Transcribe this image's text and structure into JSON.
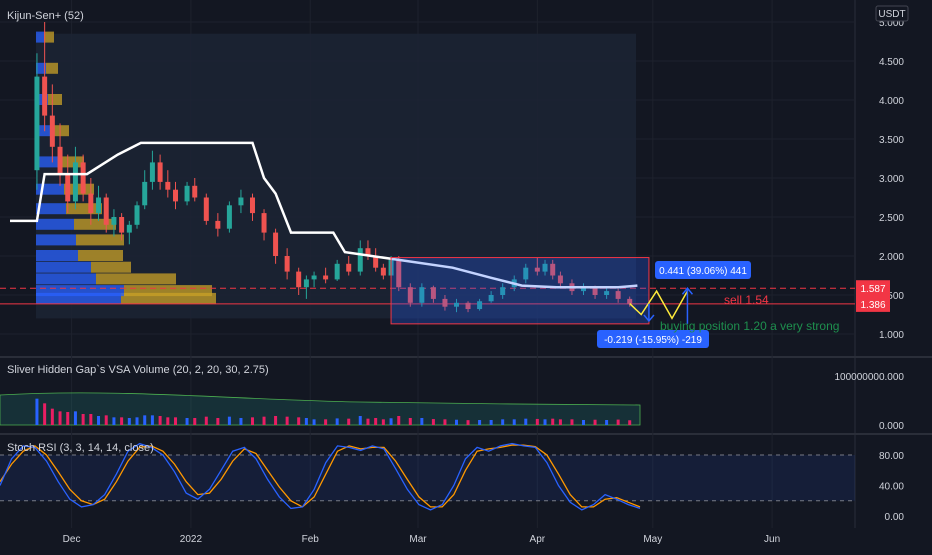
{
  "currency": "USDT",
  "panes": {
    "price": {
      "indicator_label": "Kijun-Sen+ (52)",
      "yticks": [
        "5.000",
        "4.500",
        "4.000",
        "3.500",
        "3.000",
        "2.500",
        "2.000",
        "1.500",
        "1.000"
      ],
      "price_badges": [
        {
          "label": "1.587",
          "color": "#f23645"
        },
        {
          "label": "1.386",
          "color": "#f23645"
        }
      ]
    },
    "volume": {
      "indicator_label": "Sliver Hidden Gap`s VSA Volume (20, 2, 20, 30, 2.75)",
      "yticks": [
        "100000000.000",
        "0.000"
      ]
    },
    "stoch": {
      "indicator_label": "Stoch RSI (3, 3, 14, 14, close)",
      "yticks": [
        "80.00",
        "40.00",
        "0.00"
      ]
    }
  },
  "time_axis": [
    "Dec",
    "2022",
    "Feb",
    "Mar",
    "Apr",
    "May",
    "Jun"
  ],
  "annotations": {
    "upper_measure": "0.441 (39.06%) 441",
    "lower_measure": "-0.219 (-15.95%) -219",
    "sell_text": "sell 1.54",
    "buy_text": "buying position 1.20 a very strong"
  },
  "colors": {
    "background": "#131722",
    "up": "#26a69a",
    "down": "#ef5350",
    "kijun": "#ffffff",
    "profile_blue": "#2962ff",
    "profile_gold": "#c9a227",
    "stoch_k": "#2962ff",
    "stoch_d": "#ff9800",
    "badge_blue": "#2962ff",
    "sell_red": "#f23645",
    "buy_green": "#1e8f4e"
  },
  "chart_data": {
    "type": "candlestick",
    "y_range": [
      0.8,
      5.15
    ],
    "x_range": [
      "2021-11-15",
      "2022-06-15"
    ],
    "price_lines": [
      1.587,
      1.386
    ],
    "candles": [
      {
        "date": "2021-11-22",
        "open": 3.1,
        "high": 4.6,
        "low": 2.85,
        "close": 4.3
      },
      {
        "date": "2021-11-24",
        "open": 4.3,
        "high": 5.0,
        "low": 3.6,
        "close": 3.8
      },
      {
        "date": "2021-11-26",
        "open": 3.8,
        "high": 4.2,
        "low": 3.2,
        "close": 3.4
      },
      {
        "date": "2021-11-28",
        "open": 3.4,
        "high": 3.7,
        "low": 2.9,
        "close": 3.05
      },
      {
        "date": "2021-11-30",
        "open": 3.05,
        "high": 3.3,
        "low": 2.55,
        "close": 2.7
      },
      {
        "date": "2021-12-02",
        "open": 2.7,
        "high": 3.4,
        "low": 2.6,
        "close": 3.2
      },
      {
        "date": "2021-12-04",
        "open": 3.2,
        "high": 3.3,
        "low": 2.7,
        "close": 2.8
      },
      {
        "date": "2021-12-06",
        "open": 2.8,
        "high": 3.0,
        "low": 2.4,
        "close": 2.55
      },
      {
        "date": "2021-12-08",
        "open": 2.55,
        "high": 2.9,
        "low": 2.45,
        "close": 2.75
      },
      {
        "date": "2021-12-10",
        "open": 2.75,
        "high": 2.8,
        "low": 2.3,
        "close": 2.4
      },
      {
        "date": "2021-12-12",
        "open": 2.4,
        "high": 2.6,
        "low": 2.25,
        "close": 2.5
      },
      {
        "date": "2021-12-14",
        "open": 2.5,
        "high": 2.55,
        "low": 2.2,
        "close": 2.3
      },
      {
        "date": "2021-12-16",
        "open": 2.3,
        "high": 2.45,
        "low": 2.15,
        "close": 2.4
      },
      {
        "date": "2021-12-18",
        "open": 2.4,
        "high": 2.7,
        "low": 2.35,
        "close": 2.65
      },
      {
        "date": "2021-12-20",
        "open": 2.65,
        "high": 3.1,
        "low": 2.6,
        "close": 2.95
      },
      {
        "date": "2021-12-22",
        "open": 2.95,
        "high": 3.35,
        "low": 2.85,
        "close": 3.2
      },
      {
        "date": "2021-12-24",
        "open": 3.2,
        "high": 3.3,
        "low": 2.85,
        "close": 2.95
      },
      {
        "date": "2021-12-26",
        "open": 2.95,
        "high": 3.1,
        "low": 2.75,
        "close": 2.85
      },
      {
        "date": "2021-12-28",
        "open": 2.85,
        "high": 2.95,
        "low": 2.6,
        "close": 2.7
      },
      {
        "date": "2021-12-31",
        "open": 2.7,
        "high": 2.95,
        "low": 2.65,
        "close": 2.9
      },
      {
        "date": "2022-01-02",
        "open": 2.9,
        "high": 3.0,
        "low": 2.7,
        "close": 2.75
      },
      {
        "date": "2022-01-05",
        "open": 2.75,
        "high": 2.8,
        "low": 2.4,
        "close": 2.45
      },
      {
        "date": "2022-01-08",
        "open": 2.45,
        "high": 2.55,
        "low": 2.25,
        "close": 2.35
      },
      {
        "date": "2022-01-11",
        "open": 2.35,
        "high": 2.7,
        "low": 2.3,
        "close": 2.65
      },
      {
        "date": "2022-01-14",
        "open": 2.65,
        "high": 2.85,
        "low": 2.55,
        "close": 2.75
      },
      {
        "date": "2022-01-17",
        "open": 2.75,
        "high": 2.8,
        "low": 2.45,
        "close": 2.55
      },
      {
        "date": "2022-01-20",
        "open": 2.55,
        "high": 2.6,
        "low": 2.2,
        "close": 2.3
      },
      {
        "date": "2022-01-23",
        "open": 2.3,
        "high": 2.35,
        "low": 1.9,
        "close": 2.0
      },
      {
        "date": "2022-01-26",
        "open": 2.0,
        "high": 2.1,
        "low": 1.7,
        "close": 1.8
      },
      {
        "date": "2022-01-29",
        "open": 1.8,
        "high": 1.85,
        "low": 1.5,
        "close": 1.6
      },
      {
        "date": "2022-01-31",
        "open": 1.6,
        "high": 1.75,
        "low": 1.45,
        "close": 1.7
      },
      {
        "date": "2022-02-02",
        "open": 1.7,
        "high": 1.8,
        "low": 1.6,
        "close": 1.75
      },
      {
        "date": "2022-02-05",
        "open": 1.75,
        "high": 1.85,
        "low": 1.65,
        "close": 1.7
      },
      {
        "date": "2022-02-08",
        "open": 1.7,
        "high": 1.95,
        "low": 1.68,
        "close": 1.9
      },
      {
        "date": "2022-02-11",
        "open": 1.9,
        "high": 2.0,
        "low": 1.75,
        "close": 1.8
      },
      {
        "date": "2022-02-14",
        "open": 1.8,
        "high": 2.2,
        "low": 1.75,
        "close": 2.1
      },
      {
        "date": "2022-02-16",
        "open": 2.1,
        "high": 2.2,
        "low": 1.95,
        "close": 2.0
      },
      {
        "date": "2022-02-18",
        "open": 2.0,
        "high": 2.1,
        "low": 1.8,
        "close": 1.85
      },
      {
        "date": "2022-02-20",
        "open": 1.85,
        "high": 1.9,
        "low": 1.7,
        "close": 1.75
      },
      {
        "date": "2022-02-22",
        "open": 1.75,
        "high": 2.0,
        "low": 1.72,
        "close": 1.95
      },
      {
        "date": "2022-02-24",
        "open": 1.95,
        "high": 2.0,
        "low": 1.55,
        "close": 1.6
      },
      {
        "date": "2022-02-27",
        "open": 1.6,
        "high": 1.65,
        "low": 1.35,
        "close": 1.4
      },
      {
        "date": "2022-03-02",
        "open": 1.4,
        "high": 1.65,
        "low": 1.35,
        "close": 1.6
      },
      {
        "date": "2022-03-05",
        "open": 1.6,
        "high": 1.62,
        "low": 1.4,
        "close": 1.45
      },
      {
        "date": "2022-03-08",
        "open": 1.45,
        "high": 1.5,
        "low": 1.3,
        "close": 1.35
      },
      {
        "date": "2022-03-11",
        "open": 1.35,
        "high": 1.45,
        "low": 1.28,
        "close": 1.4
      },
      {
        "date": "2022-03-14",
        "open": 1.4,
        "high": 1.42,
        "low": 1.28,
        "close": 1.32
      },
      {
        "date": "2022-03-17",
        "open": 1.32,
        "high": 1.45,
        "low": 1.3,
        "close": 1.42
      },
      {
        "date": "2022-03-20",
        "open": 1.42,
        "high": 1.55,
        "low": 1.4,
        "close": 1.5
      },
      {
        "date": "2022-03-23",
        "open": 1.5,
        "high": 1.65,
        "low": 1.45,
        "close": 1.6
      },
      {
        "date": "2022-03-26",
        "open": 1.6,
        "high": 1.75,
        "low": 1.55,
        "close": 1.7
      },
      {
        "date": "2022-03-29",
        "open": 1.7,
        "high": 1.9,
        "low": 1.65,
        "close": 1.85
      },
      {
        "date": "2022-04-01",
        "open": 1.85,
        "high": 1.98,
        "low": 1.75,
        "close": 1.8
      },
      {
        "date": "2022-04-03",
        "open": 1.8,
        "high": 1.95,
        "low": 1.75,
        "close": 1.9
      },
      {
        "date": "2022-04-05",
        "open": 1.9,
        "high": 1.95,
        "low": 1.7,
        "close": 1.75
      },
      {
        "date": "2022-04-07",
        "open": 1.75,
        "high": 1.8,
        "low": 1.6,
        "close": 1.65
      },
      {
        "date": "2022-04-10",
        "open": 1.65,
        "high": 1.7,
        "low": 1.5,
        "close": 1.55
      },
      {
        "date": "2022-04-13",
        "open": 1.55,
        "high": 1.65,
        "low": 1.5,
        "close": 1.6
      },
      {
        "date": "2022-04-16",
        "open": 1.6,
        "high": 1.62,
        "low": 1.45,
        "close": 1.5
      },
      {
        "date": "2022-04-19",
        "open": 1.5,
        "high": 1.6,
        "low": 1.45,
        "close": 1.55
      },
      {
        "date": "2022-04-22",
        "open": 1.55,
        "high": 1.58,
        "low": 1.4,
        "close": 1.45
      },
      {
        "date": "2022-04-25",
        "open": 1.45,
        "high": 1.48,
        "low": 1.35,
        "close": 1.39
      }
    ],
    "kijun": {
      "dates": [
        "2021-11-15",
        "2021-11-22",
        "2021-11-24",
        "2021-12-05",
        "2021-12-13",
        "2021-12-19",
        "2022-01-17",
        "2022-01-20",
        "2022-01-23",
        "2022-01-27",
        "2022-02-07",
        "2022-02-10",
        "2022-02-24",
        "2022-03-10",
        "2022-03-20",
        "2022-03-28",
        "2022-04-06",
        "2022-04-22",
        "2022-04-27"
      ],
      "values": [
        2.45,
        2.45,
        3.05,
        3.05,
        3.3,
        3.45,
        3.45,
        3.0,
        2.8,
        2.3,
        2.3,
        2.05,
        1.95,
        1.85,
        1.72,
        1.62,
        1.6,
        1.6,
        1.62
      ]
    },
    "volume_profile": {
      "price_levels": [
        1.45,
        1.55,
        1.7,
        1.85,
        2.0,
        2.2,
        2.4,
        2.6,
        2.85,
        3.2,
        3.6,
        4.0,
        4.4,
        4.8
      ],
      "up_volume": [
        85,
        88,
        60,
        55,
        42,
        40,
        38,
        30,
        28,
        22,
        15,
        12,
        10,
        8
      ],
      "down_volume": [
        95,
        88,
        80,
        40,
        45,
        48,
        42,
        36,
        30,
        26,
        18,
        14,
        12,
        10
      ]
    },
    "projection": {
      "dates": [
        "2022-04-25",
        "2022-04-28",
        "2022-05-02",
        "2022-05-06",
        "2022-05-10"
      ],
      "values": [
        1.39,
        1.25,
        1.55,
        1.2,
        1.55
      ]
    },
    "measure_ranges": [
      {
        "from": 1.13,
        "to": 1.587,
        "date": "2022-05-10"
      },
      {
        "from": 1.386,
        "to": 1.167,
        "date": "2022-04-30"
      }
    ],
    "stoch_rsi": {
      "k": [
        40,
        75,
        92,
        90,
        72,
        45,
        22,
        12,
        15,
        28,
        55,
        85,
        95,
        90,
        80,
        58,
        30,
        22,
        35,
        60,
        85,
        90,
        75,
        48,
        25,
        10,
        12,
        35,
        70,
        92,
        90,
        86,
        92,
        88,
        62,
        35,
        15,
        8,
        15,
        40,
        75,
        90,
        85,
        92,
        95,
        92,
        90,
        70,
        40,
        18,
        8,
        15,
        28,
        22,
        15,
        10
      ],
      "d": [
        45,
        68,
        85,
        92,
        80,
        58,
        35,
        20,
        15,
        22,
        45,
        72,
        90,
        92,
        85,
        68,
        45,
        28,
        30,
        48,
        72,
        88,
        82,
        60,
        38,
        20,
        12,
        25,
        55,
        85,
        92,
        88,
        90,
        90,
        72,
        48,
        25,
        12,
        12,
        28,
        60,
        85,
        88,
        90,
        93,
        93,
        91,
        80,
        55,
        28,
        12,
        12,
        22,
        24,
        18,
        12
      ]
    }
  }
}
